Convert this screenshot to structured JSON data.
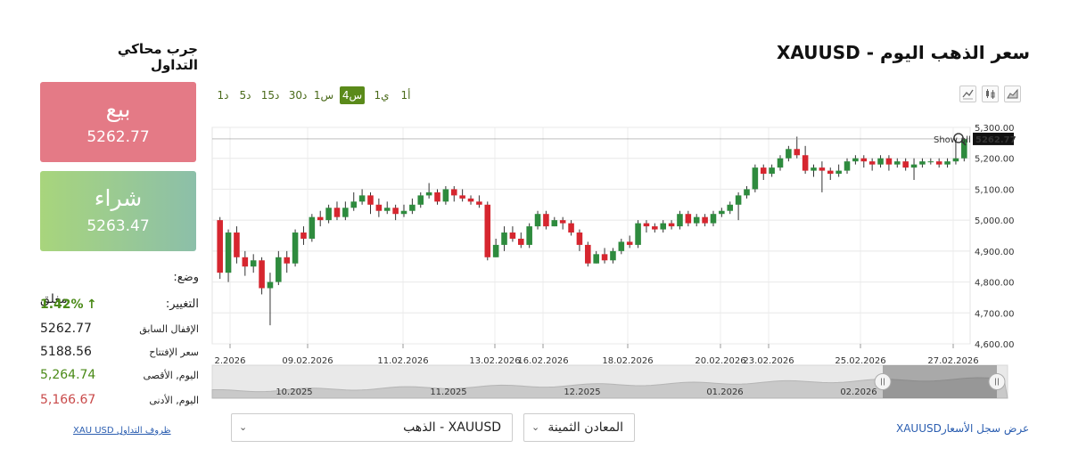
{
  "simulator": {
    "title": "جرب محاكي التداول",
    "sell_label": "بيع",
    "sell_price": "5262.77",
    "buy_label": "شراء",
    "buy_price": "5263.47",
    "status_label": "وضع:",
    "status_value": "مغلق",
    "change_label": "التغيير:",
    "change_value": "1.42%",
    "change_arrow": "↑",
    "prev_close_label": "الإقفال السابق",
    "prev_close_value": "5262.77",
    "open_label": "سعر الإفتتاح",
    "open_value": "5188.56",
    "high_label": "اليوم, الأقصى",
    "high_value": "5,264.74",
    "low_label": "اليوم, الأدنى",
    "low_value": "5,166.67",
    "terms_link": "XAU USD ظروف التداول"
  },
  "header": {
    "title": "سعر الذهب اليوم - XAUUSD"
  },
  "timeframes": [
    "1أ",
    "1ي",
    "4س",
    "1س",
    "30د",
    "15د",
    "5د",
    "1د"
  ],
  "active_timeframe": "4س",
  "chart_types": [
    "line-chart-icon",
    "candlestick-icon",
    "bar-chart-icon"
  ],
  "chart": {
    "show_all": "Show all",
    "current_price_tag": "5262.77",
    "navigator_labels": [
      "10.2025",
      "11.2025",
      "12.2025",
      "01.2026",
      "02.2026"
    ]
  },
  "controls": {
    "category_select": "المعادن الثمينة",
    "symbol_select": "XAUUSD - الذهب",
    "history_symbol": "XAUUSD",
    "history_text": "عرض سجل الأسعار"
  },
  "colors": {
    "up": "#2e8b3e",
    "down": "#d6262f",
    "accent": "#5a8a1a",
    "sell": "#e47a86",
    "buy": "#a8d57c"
  },
  "chart_data": {
    "type": "candlestick",
    "series_interval": "4h",
    "ylim": [
      4600,
      5300
    ],
    "y_ticks": [
      4600,
      4700,
      4800,
      4900,
      5000,
      5100,
      5200,
      5300
    ],
    "y_tick_labels": [
      "4,600.00",
      "4,700.00",
      "4,800.00",
      "4,900.00",
      "5,000.00",
      "5,100.00",
      "5,200.00",
      "5,300.00"
    ],
    "x_tick_labels": [
      "2.2026",
      "09.02.2026",
      "11.02.2026",
      "13.02.2026",
      "16.02.2026",
      "18.02.2026",
      "20.02.2026",
      "23.02.2026",
      "25.02.2026",
      "27.02.2026"
    ],
    "last_price": 5262.77,
    "candles": [
      [
        5000,
        4830,
        5010,
        4810
      ],
      [
        4830,
        4960,
        4970,
        4800
      ],
      [
        4960,
        4880,
        4980,
        4860
      ],
      [
        4880,
        4850,
        4900,
        4820
      ],
      [
        4850,
        4870,
        4890,
        4830
      ],
      [
        4870,
        4780,
        4880,
        4760
      ],
      [
        4780,
        4800,
        4830,
        4660
      ],
      [
        4800,
        4880,
        4900,
        4790
      ],
      [
        4880,
        4860,
        4900,
        4830
      ],
      [
        4860,
        4960,
        4970,
        4850
      ],
      [
        4960,
        4940,
        4980,
        4920
      ],
      [
        4940,
        5010,
        5020,
        4930
      ],
      [
        5010,
        5000,
        5030,
        4980
      ],
      [
        5000,
        5040,
        5050,
        4990
      ],
      [
        5040,
        5010,
        5060,
        5000
      ],
      [
        5010,
        5040,
        5060,
        5000
      ],
      [
        5040,
        5060,
        5090,
        5030
      ],
      [
        5060,
        5080,
        5100,
        5050
      ],
      [
        5080,
        5050,
        5090,
        5020
      ],
      [
        5050,
        5030,
        5070,
        5010
      ],
      [
        5030,
        5040,
        5060,
        5020
      ],
      [
        5040,
        5020,
        5050,
        5000
      ],
      [
        5020,
        5030,
        5050,
        5010
      ],
      [
        5030,
        5050,
        5070,
        5020
      ],
      [
        5050,
        5080,
        5090,
        5040
      ],
      [
        5080,
        5090,
        5120,
        5070
      ],
      [
        5090,
        5060,
        5100,
        5050
      ],
      [
        5060,
        5100,
        5110,
        5050
      ],
      [
        5100,
        5080,
        5110,
        5060
      ],
      [
        5080,
        5070,
        5100,
        5060
      ],
      [
        5070,
        5060,
        5080,
        5050
      ],
      [
        5060,
        5050,
        5080,
        5040
      ],
      [
        5050,
        4880,
        5060,
        4870
      ],
      [
        4880,
        4920,
        4940,
        4880
      ],
      [
        4920,
        4960,
        4980,
        4900
      ],
      [
        4960,
        4940,
        4980,
        4930
      ],
      [
        4940,
        4920,
        4960,
        4910
      ],
      [
        4920,
        4980,
        4990,
        4910
      ],
      [
        4980,
        5020,
        5030,
        4970
      ],
      [
        5020,
        4980,
        5030,
        4970
      ],
      [
        4980,
        5000,
        5010,
        4980
      ],
      [
        5000,
        4990,
        5010,
        4970
      ],
      [
        4990,
        4960,
        5000,
        4950
      ],
      [
        4960,
        4920,
        4970,
        4900
      ],
      [
        4920,
        4860,
        4930,
        4850
      ],
      [
        4860,
        4890,
        4900,
        4860
      ],
      [
        4890,
        4870,
        4910,
        4860
      ],
      [
        4870,
        4900,
        4910,
        4860
      ],
      [
        4900,
        4930,
        4940,
        4890
      ],
      [
        4930,
        4920,
        4950,
        4910
      ],
      [
        4920,
        4990,
        5000,
        4910
      ],
      [
        4990,
        4980,
        5000,
        4960
      ],
      [
        4980,
        4970,
        4990,
        4960
      ],
      [
        4970,
        4990,
        5000,
        4960
      ],
      [
        4990,
        4980,
        5000,
        4970
      ],
      [
        4980,
        5020,
        5030,
        4970
      ],
      [
        5020,
        4990,
        5030,
        4980
      ],
      [
        4990,
        5010,
        5020,
        4980
      ],
      [
        5010,
        4990,
        5020,
        4980
      ],
      [
        4990,
        5020,
        5030,
        4980
      ],
      [
        5020,
        5030,
        5040,
        5010
      ],
      [
        5030,
        5050,
        5060,
        5020
      ],
      [
        5050,
        5080,
        5090,
        5000
      ],
      [
        5080,
        5100,
        5110,
        5070
      ],
      [
        5100,
        5170,
        5180,
        5090
      ],
      [
        5170,
        5150,
        5180,
        5130
      ],
      [
        5150,
        5170,
        5180,
        5140
      ],
      [
        5170,
        5200,
        5210,
        5160
      ],
      [
        5200,
        5230,
        5240,
        5190
      ],
      [
        5230,
        5210,
        5270,
        5200
      ],
      [
        5210,
        5160,
        5240,
        5150
      ],
      [
        5160,
        5170,
        5180,
        5140
      ],
      [
        5170,
        5160,
        5190,
        5090
      ],
      [
        5160,
        5150,
        5170,
        5130
      ],
      [
        5150,
        5160,
        5180,
        5140
      ],
      [
        5160,
        5190,
        5200,
        5150
      ],
      [
        5190,
        5200,
        5210,
        5180
      ],
      [
        5200,
        5190,
        5210,
        5170
      ],
      [
        5190,
        5180,
        5200,
        5160
      ],
      [
        5180,
        5200,
        5210,
        5170
      ],
      [
        5200,
        5180,
        5210,
        5160
      ],
      [
        5180,
        5190,
        5200,
        5170
      ],
      [
        5190,
        5170,
        5200,
        5160
      ],
      [
        5170,
        5180,
        5200,
        5130
      ],
      [
        5180,
        5190,
        5200,
        5170
      ],
      [
        5190,
        5190,
        5200,
        5180
      ],
      [
        5190,
        5180,
        5200,
        5170
      ],
      [
        5180,
        5190,
        5200,
        5170
      ],
      [
        5190,
        5200,
        5260,
        5180
      ],
      [
        5200,
        5263,
        5265,
        5190
      ]
    ]
  }
}
